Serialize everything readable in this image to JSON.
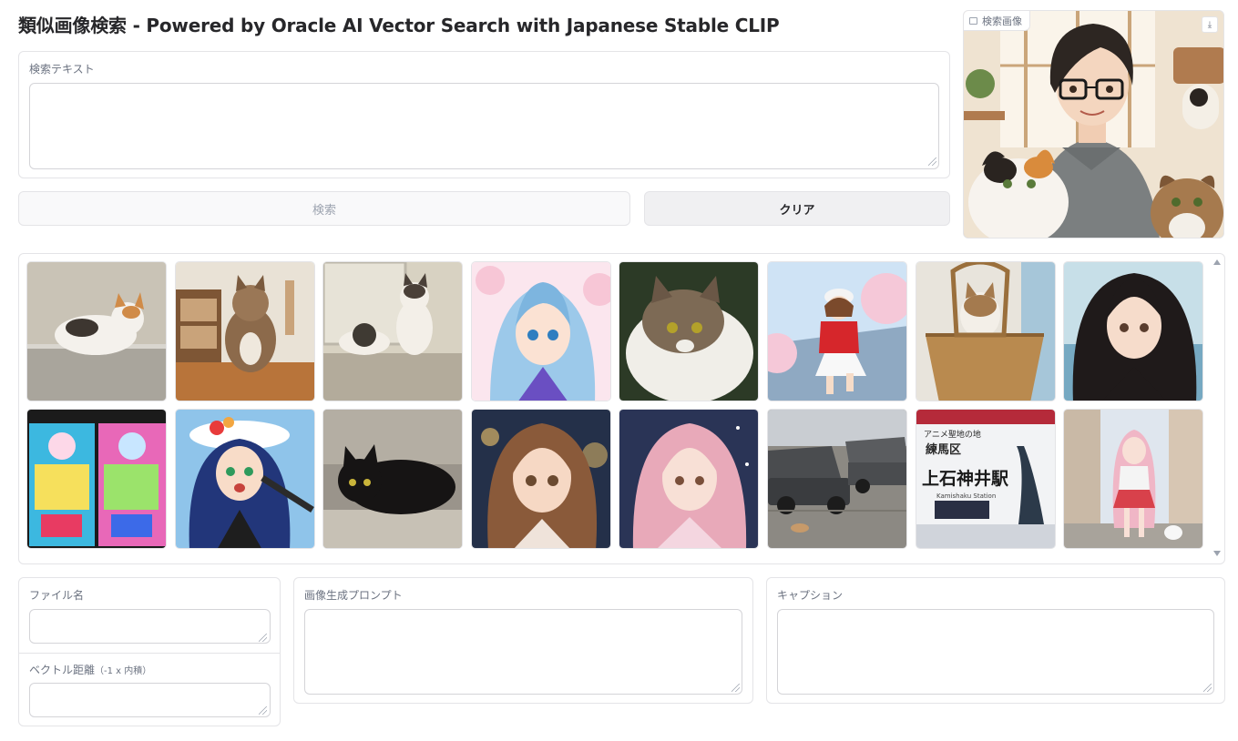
{
  "app": {
    "title": "類似画像検索 - Powered by Oracle AI Vector Search with Japanese Stable CLIP"
  },
  "search_text": {
    "label": "検索テキスト",
    "value": "",
    "placeholder": ""
  },
  "buttons": {
    "search_label": "検索",
    "clear_label": "クリア"
  },
  "query_image": {
    "label": "検索画像",
    "download_icon": "download-icon"
  },
  "gallery": {
    "images": [
      {
        "subject": "calico kitten on ledge"
      },
      {
        "subject": "tabby cat sitting by shelf"
      },
      {
        "subject": "two kittens by window"
      },
      {
        "subject": "anime girl blue hair cherry blossoms"
      },
      {
        "subject": "fluffy white and tabby cat"
      },
      {
        "subject": "anime girl red jacket running"
      },
      {
        "subject": "kitten in wicker basket"
      },
      {
        "subject": "anime girl dark hair gothic"
      },
      {
        "subject": "anime postcards with stickers"
      },
      {
        "subject": "anime girl singing with microphone"
      },
      {
        "subject": "black cat on wooden stump"
      },
      {
        "subject": "anime girl brown hair portrait"
      },
      {
        "subject": "anime girl pink hair night sky"
      },
      {
        "subject": "parked cars with cat"
      },
      {
        "subject": "station sign"
      },
      {
        "subject": "anime girl pink hair street with dog"
      }
    ],
    "sign_text": {
      "top": "アニメ聖地の地",
      "ward": "練馬区",
      "station": "上石神井駅",
      "roman": "Kamishaku Station"
    }
  },
  "fields": {
    "filename_label": "ファイル名",
    "filename_value": "",
    "distance_label": "ベクトル距離",
    "distance_sub": "（-1 x 内積）",
    "distance_value": "",
    "prompt_label": "画像生成プロンプト",
    "prompt_value": "",
    "caption_label": "キャプション",
    "caption_value": ""
  },
  "colors": {
    "border": "#e4e4e7",
    "muted_text": "#6b7280",
    "disabled_text": "#9ca3af"
  }
}
